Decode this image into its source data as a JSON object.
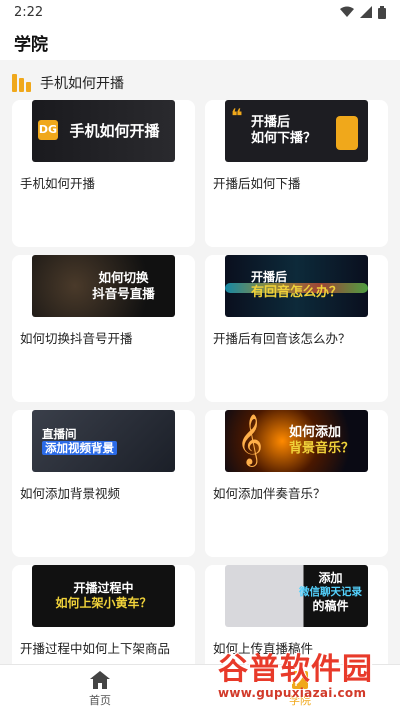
{
  "status_bar": {
    "time": "2:22"
  },
  "app_bar": {
    "title": "学院"
  },
  "section": {
    "title": "手机如何开播"
  },
  "cards": [
    {
      "title": "手机如何开播",
      "thumb_line1": "手机如何开播",
      "thumb_line2": "",
      "badge": "DG"
    },
    {
      "title": "开播后如何下播",
      "thumb_line1": "开播后",
      "thumb_line2": "如何下播？"
    },
    {
      "title": "如何切换抖音号开播",
      "thumb_line1": "如何切换",
      "thumb_line2": "抖音号直播"
    },
    {
      "title": "开播后有回音该怎么办？",
      "thumb_line1": "开播后",
      "thumb_line2": "有回音怎么办？"
    },
    {
      "title": "如何添加背景视频",
      "thumb_line1": "直播间",
      "thumb_line2": "添加视频背景"
    },
    {
      "title": "如何添加伴奏音乐？",
      "thumb_line1": "如何添加",
      "thumb_line2": "背景音乐？"
    },
    {
      "title": "开播过程中如何上下架商品",
      "thumb_line1": "开播过程中",
      "thumb_line2": "如何上架小黄车？"
    },
    {
      "title": "如何上传直播稿件",
      "thumb_line1": "添加",
      "thumb_line2": "微信聊天记录",
      "thumb_line3": "的稿件"
    }
  ],
  "bottom_nav": {
    "items": [
      {
        "label": "首页",
        "icon": "home-icon",
        "active": false
      },
      {
        "label": "学院",
        "icon": "book-icon",
        "active": true
      }
    ]
  },
  "watermark": {
    "main": "谷普软件园",
    "sub": "www.gupuxiazai.com"
  },
  "colors": {
    "accent": "#f0a81b",
    "background": "#f4f4f4",
    "card": "#ffffff"
  }
}
